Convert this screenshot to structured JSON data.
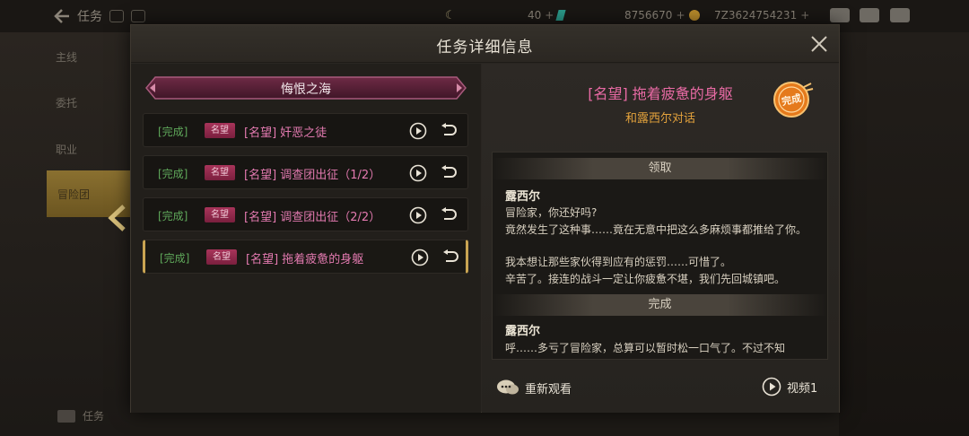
{
  "topbar": {
    "title": "任务",
    "resources": [
      {
        "value": "40",
        "icon": "gem-icon"
      },
      {
        "value": "8756670",
        "icon": "coin-icon"
      },
      {
        "value": "7Z3624754231",
        "icon": "gold-coin-icon"
      }
    ]
  },
  "sidebar": {
    "items": [
      {
        "label": "主线"
      },
      {
        "label": "委托"
      },
      {
        "label": "职业"
      },
      {
        "label": "冒险团"
      }
    ],
    "bottom_label": "任务"
  },
  "dialog": {
    "title": "任务详细信息",
    "zone_name": "悔恨之海",
    "quests": [
      {
        "status": "[完成]",
        "tag": "名望",
        "name": "[名望] 奸恶之徒"
      },
      {
        "status": "[完成]",
        "tag": "名望",
        "name": "[名望] 调查团出征（1/2）"
      },
      {
        "status": "[完成]",
        "tag": "名望",
        "name": "[名望] 调查团出征（2/2）"
      },
      {
        "status": "[完成]",
        "tag": "名望",
        "name": "[名望] 拖着疲惫的身躯"
      }
    ],
    "detail": {
      "title": "[名望] 拖着疲惫的身躯",
      "subtitle": "和露西尔对话",
      "seal_text": "完成",
      "sections": [
        {
          "header": "领取",
          "speaker": "露西尔",
          "lines": [
            "冒险家，你还好吗?",
            "竟然发生了这种事……竟在无意中把这么多麻烦事都推给了你。",
            "我本想让那些家伙得到应有的惩罚……可惜了。",
            "辛苦了。接连的战斗一定让你疲惫不堪，我们先回城镇吧。"
          ]
        },
        {
          "header": "完成",
          "speaker": "露西尔",
          "lines": [
            "呼……多亏了冒险家，总算可以暂时松一口气了。不过不知"
          ]
        }
      ],
      "replay_label": "重新观看",
      "video_label": "视频1"
    }
  }
}
